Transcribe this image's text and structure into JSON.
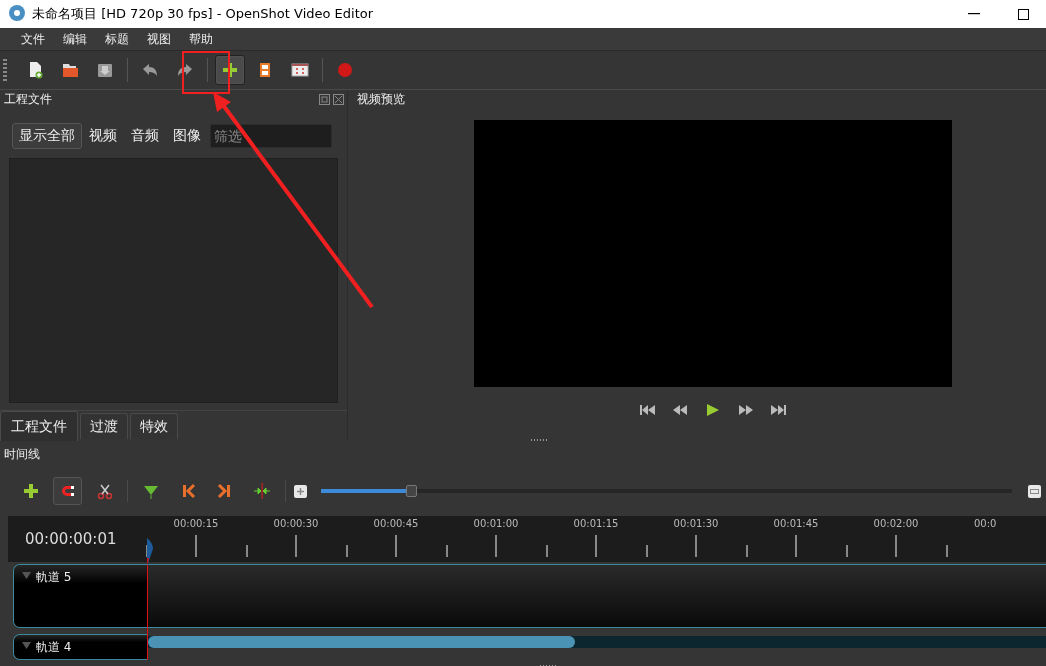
{
  "window": {
    "title": "未命名项目 [HD 720p 30 fps] - OpenShot Video Editor"
  },
  "menu": [
    "文件",
    "编辑",
    "标题",
    "视图",
    "帮助"
  ],
  "toolbar": [
    {
      "hovered": false
    },
    {
      "hovered": false
    },
    {
      "hovered": false
    },
    {
      "hovered": false
    },
    {
      "hovered": false
    },
    {
      "hovered": true
    },
    {
      "hovered": false
    },
    {
      "hovered": false
    },
    {
      "hovered": false
    }
  ],
  "project_panel": {
    "title": "工程文件",
    "filters": [
      {
        "label": "显示全部",
        "selected": true
      },
      {
        "label": "视频",
        "selected": false
      },
      {
        "label": "音频",
        "selected": false
      },
      {
        "label": "图像",
        "selected": false
      }
    ],
    "search": {
      "placeholder": "筛选"
    },
    "tabs": [
      {
        "label": "工程文件",
        "selected": true
      },
      {
        "label": "过渡",
        "selected": false
      },
      {
        "label": "特效",
        "selected": false
      }
    ]
  },
  "preview_panel": {
    "title": "视频预览"
  },
  "timeline": {
    "title": "时间线",
    "tools": [
      {
        "on": false
      },
      {
        "on": true
      },
      {
        "on": false
      },
      {
        "on": false
      },
      {
        "on": false
      },
      {
        "on": false
      },
      {
        "on": false
      }
    ],
    "zoom": {
      "level": 0.14
    },
    "current_time": "00:00:00:01",
    "ruler_labels": [
      "00:00:15",
      "00:00:30",
      "00:00:45",
      "00:01:00",
      "00:01:15",
      "00:01:30",
      "00:01:45",
      "00:02:00",
      "00:0"
    ],
    "tracks": [
      {
        "name": "軌道 5"
      },
      {
        "name": "軌道 4"
      }
    ]
  }
}
